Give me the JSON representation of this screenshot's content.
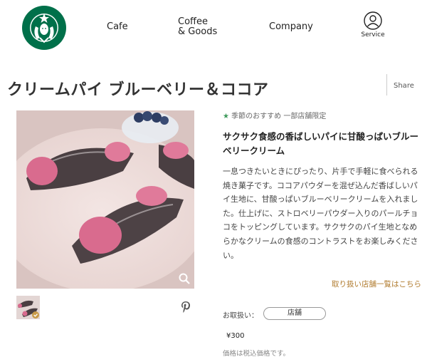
{
  "header": {
    "nav": {
      "cafe": "Cafe",
      "coffee_line1": "Coffee",
      "coffee_line2": "& Goods",
      "company": "Company"
    },
    "service_label": "Service"
  },
  "product": {
    "title": "クリームパイ ブルーベリー＆ココア",
    "share_label": "Share",
    "badge": "季節のおすすめ 一部店舗限定",
    "subtitle": "サクサク食感の香ばしいパイに甘酸っぱいブルーベリークリーム",
    "description": "一息つきたいときにぴったり、片手で手軽に食べられる焼き菓子です。ココアパウダーを混ぜ込んだ香ばしいパイ生地に、甘酸っぱいブルーベリークリームを入れました。仕上げに、ストロベリーパウダー入りのパールチョコをトッピングしています。サクサクのパイ生地となめらかなクリームの食感のコントラストをお楽しみください。",
    "store_link": "取り扱い店舗一覧はこちら",
    "handling_label": "お取扱い：",
    "handling_value": "店舗",
    "price": "¥300",
    "tax_note": "価格は税込価格です。"
  },
  "colors": {
    "accent_green": "#3e9a5b",
    "link_gold": "#b07b2e",
    "logo_green": "#00704a"
  },
  "icons": [
    "starbucks-logo",
    "user-icon",
    "zoom-icon",
    "pinterest-icon",
    "check-icon",
    "star-icon"
  ]
}
